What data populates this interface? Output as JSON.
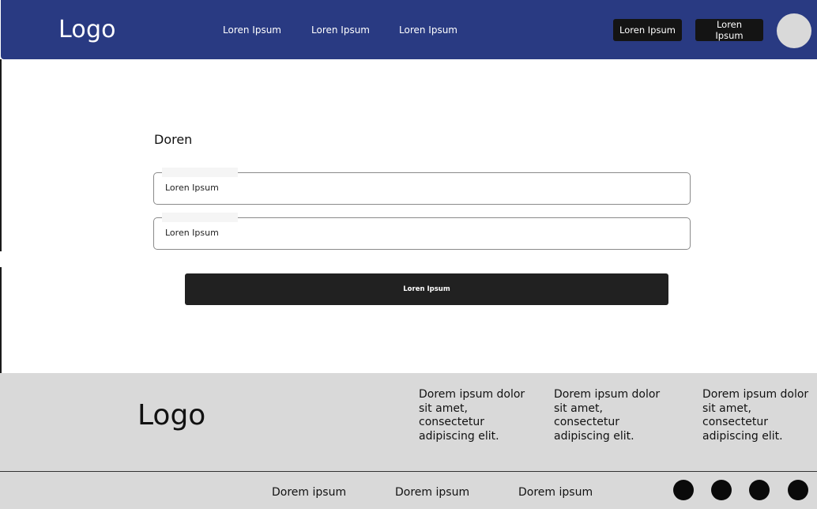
{
  "header": {
    "logo": "Logo",
    "nav": [
      "Loren Ipsum",
      "Loren Ipsum",
      "Loren Ipsum"
    ],
    "buttons": [
      "Loren Ipsum",
      "Loren Ipsum"
    ],
    "background_color": "#293a82"
  },
  "form": {
    "title": "Doren",
    "fields": [
      {
        "placeholder": "Loren Ipsum"
      },
      {
        "placeholder": "Loren Ipsum"
      }
    ],
    "submit_label": "Loren Ipsum"
  },
  "footer": {
    "logo": "Logo",
    "columns": [
      "Dorem ipsum dolor sit amet, consectetur adipiscing elit.",
      "Dorem ipsum dolor sit amet, consectetur adipiscing elit.",
      "Dorem ipsum dolor sit amet, consectetur adipiscing elit."
    ],
    "links": [
      "Dorem ipsum",
      "Dorem ipsum",
      "Dorem ipsum"
    ],
    "social_icons": [
      "social-icon-1",
      "social-icon-2",
      "social-icon-3",
      "social-icon-4"
    ]
  }
}
